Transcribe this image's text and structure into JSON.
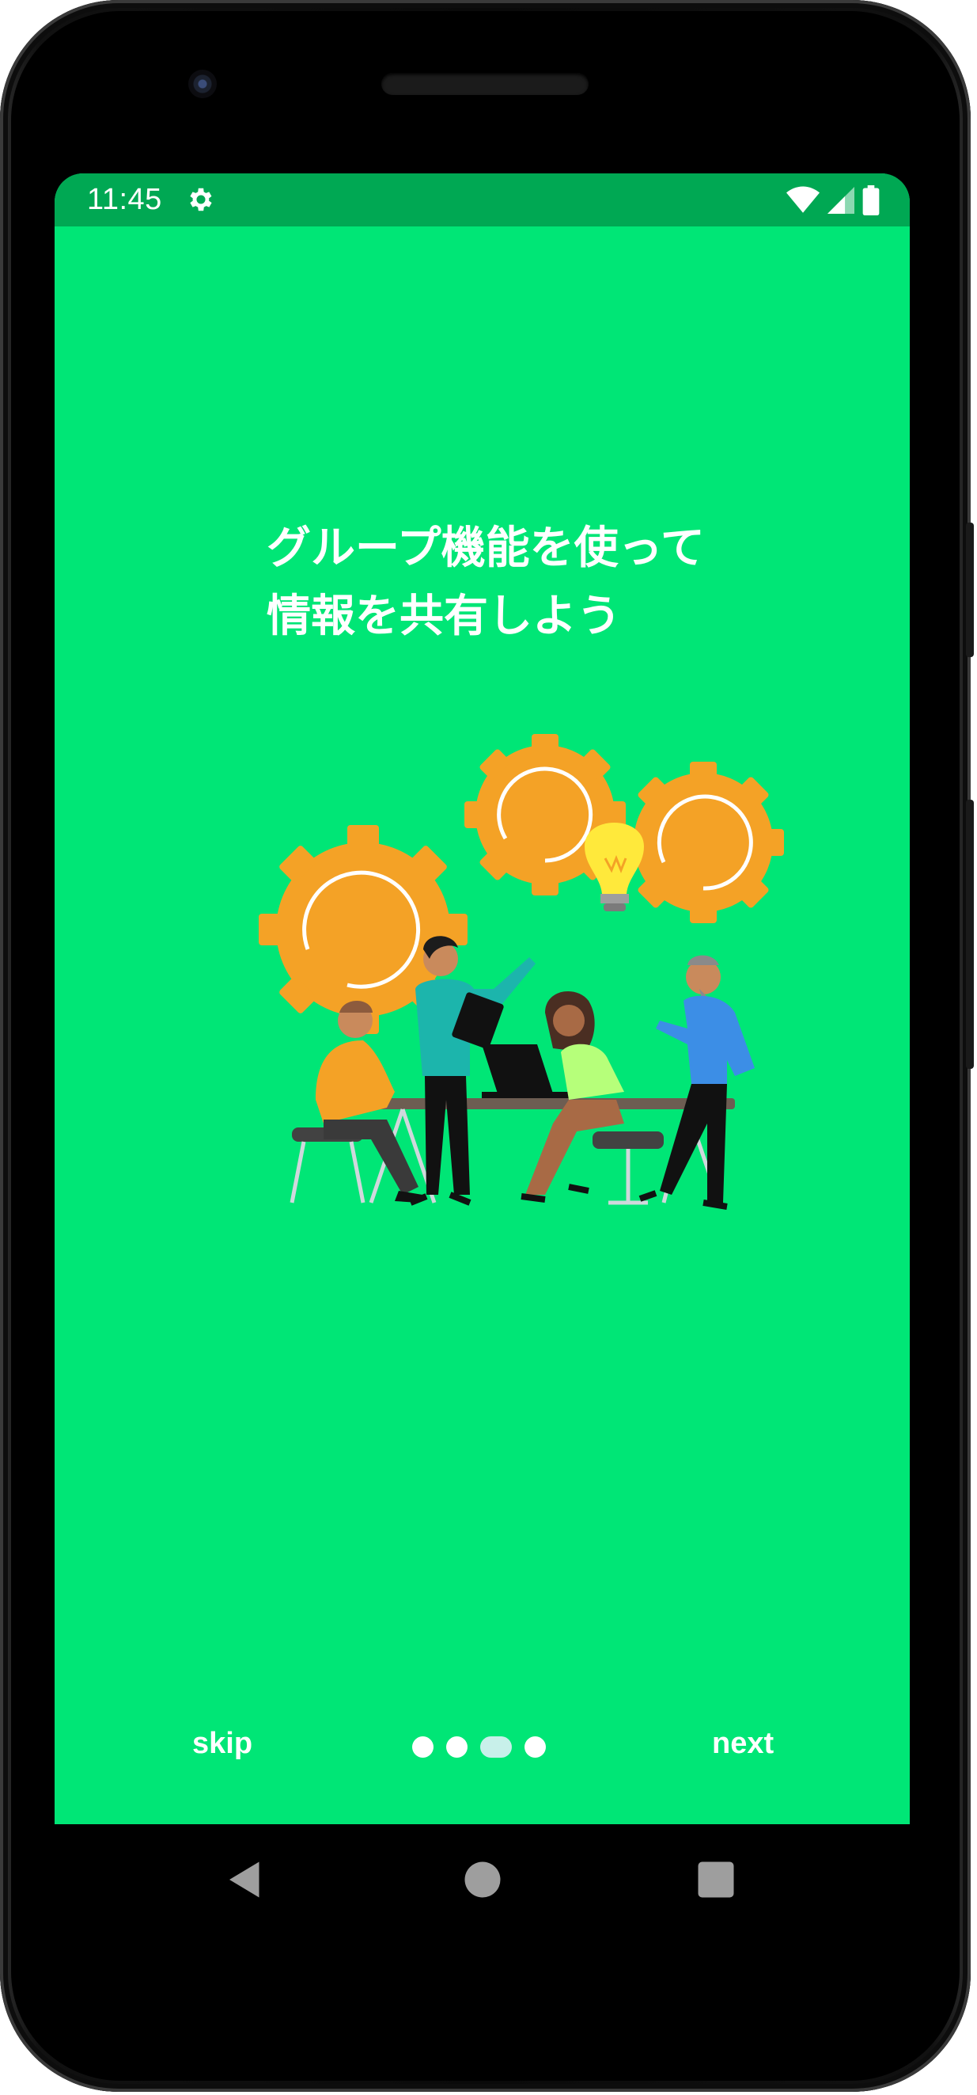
{
  "statusbar": {
    "time": "11:45",
    "icons": [
      "settings-gear-icon",
      "wifi-icon",
      "cellular-signal-icon",
      "battery-icon"
    ]
  },
  "onboarding": {
    "title_line1": "グループ機能を使って",
    "title_line2": "情報を共有しよう",
    "illustration": "team-collaboration-gears-lightbulb-illustration"
  },
  "controls": {
    "skip_label": "skip",
    "next_label": "next",
    "page_count": 4,
    "current_page": 3
  },
  "navbar": {
    "icons": [
      "back-icon",
      "home-icon",
      "recents-icon"
    ]
  },
  "colors": {
    "background": "#00e676",
    "statusbar": "#00a853",
    "gear": "#f4a226",
    "bulb": "#ffe93b",
    "active_dot": "#c8f0ea"
  }
}
